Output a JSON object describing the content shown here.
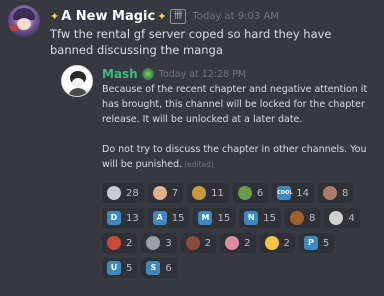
{
  "message": {
    "author": "A New Magic",
    "author_badge": "卌",
    "timestamp": "Today at 9:03 AM",
    "text": "Tfw the rental gf server coped so hard they have banned discussing the manga"
  },
  "quote": {
    "author": "Mash",
    "timestamp": "Today at 12:28 PM",
    "paragraph1": "Because of the recent chapter and negative attention it has brought, this channel will be locked for the chapter release. It will be unlocked at a later date.",
    "paragraph2": "Do not try to discuss the chapter in other channels. You will be punished.",
    "edited_label": "(edited)"
  },
  "reactions": {
    "r1": [
      {
        "icon": "face-sticker-icon",
        "glyph": "",
        "color": "#c7cbd3",
        "count": "28"
      },
      {
        "icon": "anime-girl-icon",
        "glyph": "",
        "color": "#e3b08a",
        "count": "7"
      },
      {
        "icon": "manga-panel-icon",
        "glyph": "",
        "color": "#c99a3a",
        "count": "11"
      },
      {
        "icon": "critter-icon",
        "glyph": "",
        "color": "#6a9a4a",
        "count": "6"
      },
      {
        "icon": "cool-icon",
        "glyph": "COOL",
        "color": "#3b88c3",
        "count": "14"
      },
      {
        "icon": "anime-face-icon",
        "glyph": "",
        "color": "#b07a6a",
        "count": "8"
      }
    ],
    "r2": [
      {
        "icon": "letter-d-icon",
        "glyph": "D",
        "color": "#3b88c3",
        "count": "13"
      },
      {
        "icon": "letter-a-icon",
        "glyph": "A",
        "color": "#3b88c3",
        "count": "15"
      },
      {
        "icon": "letter-m-icon",
        "glyph": "M",
        "color": "#3b88c3",
        "count": "15"
      },
      {
        "icon": "letter-n-icon",
        "glyph": "N",
        "color": "#3b88c3",
        "count": "15"
      },
      {
        "icon": "scene-icon",
        "glyph": "",
        "color": "#a0602a",
        "count": "8"
      },
      {
        "icon": "character-icon",
        "glyph": "",
        "color": "#d0d0d0",
        "count": "4"
      }
    ],
    "r3": [
      {
        "icon": "red-hair-girl-icon",
        "glyph": "",
        "color": "#c84a3a",
        "count": "2"
      },
      {
        "icon": "cat-icon",
        "glyph": "",
        "color": "#9aa0aa",
        "count": "3"
      },
      {
        "icon": "brown-hair-girl-icon",
        "glyph": "",
        "color": "#8a4a3a",
        "count": "2"
      },
      {
        "icon": "pink-face-icon",
        "glyph": "",
        "color": "#e08aa0",
        "count": "2"
      },
      {
        "icon": "relieved-face-icon",
        "glyph": "",
        "color": "#f5c542",
        "count": "2"
      },
      {
        "icon": "letter-p-icon",
        "glyph": "P",
        "color": "#3b88c3",
        "count": "5"
      }
    ],
    "r4": [
      {
        "icon": "letter-u-icon",
        "glyph": "U",
        "color": "#3b88c3",
        "count": "5"
      },
      {
        "icon": "letter-s-icon",
        "glyph": "S",
        "color": "#3b88c3",
        "count": "6"
      }
    ]
  }
}
